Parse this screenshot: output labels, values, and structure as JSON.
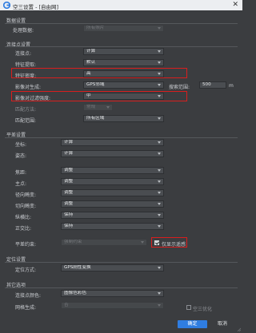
{
  "window": {
    "title": "空三设置 - [自由网]",
    "close_glyph": "✕"
  },
  "data_settings": {
    "section": "数据设置",
    "processing_data_label": "处理数据:",
    "processing_data_value": "所有照片"
  },
  "options": {
    "section": "连接点设置",
    "tie_point_label": "连接点:",
    "tie_point_value": "计算",
    "feature_extraction_label": "特征提取:",
    "feature_extraction_value": "默认",
    "feature_density_label": "特征密度:",
    "feature_density_value": "高",
    "image_pair_gen_label": "影像对生成:",
    "image_pair_gen_value": "GPS邻域",
    "search_range_label": "搜索范围:",
    "search_range_value": "500",
    "search_range_unit": "m",
    "image_pair_filter_label": "影像对过滤强度:",
    "image_pair_filter_value": "中",
    "match_mode_label": "匹配方法:",
    "match_mode_value": "常规",
    "match_range_label": "匹配范围:",
    "match_range_value": "所有区域"
  },
  "adjustment": {
    "section": "平差设置",
    "position_label": "坐标:",
    "position_value": "计算",
    "attitude_label": "姿态:",
    "attitude_value": "计算",
    "focal_label": "焦距:",
    "focal_value": "调整",
    "principal_label": "主点:",
    "principal_value": "调整",
    "radial_label": "径向畸变:",
    "radial_value": "调整",
    "tangential_label": "切向畸变:",
    "tangential_value": "调整",
    "aspect_label": "纵横比:",
    "aspect_value": "保持",
    "skew_label": "正交比:",
    "skew_value": "保持",
    "mode_label": "平差约束:",
    "mode_value": "强制约束",
    "show_remote_label": "仅显示遥感"
  },
  "positioning": {
    "section": "定位设置",
    "mode_label": "定位方式:",
    "mode_value": "GPS刚性变换"
  },
  "other": {
    "section": "其它选项",
    "tie_color_label": "连接点颜色:",
    "tie_color_value": "图像色彩色",
    "grid_gen_label": "网格生成:",
    "grid_gen_value": "否",
    "optimize_label": "空三优化"
  },
  "footer": {
    "ok": "确定",
    "cancel": "取消"
  },
  "colors": {
    "accent": "#2f7de1",
    "highlight": "#d81e1e",
    "background": "#3b3d40"
  }
}
